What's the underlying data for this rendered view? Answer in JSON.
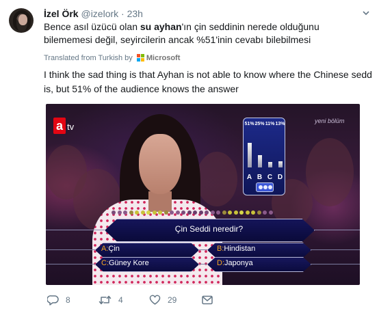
{
  "tweet": {
    "author_name": "İzel Örk",
    "author_handle": "@izelork",
    "separator": "·",
    "time": "23h",
    "text_before": "Bence asıl üzücü olan ",
    "text_bold": "su ayhan",
    "text_after": "'ın çin seddinin nerede olduğunu bilememesi değil, seyircilerin ancak %51'inin cevabı bilebilmesi",
    "translated_label": "Translated from Turkish by",
    "translator_name": "Microsoft",
    "translation": "I think the sad thing is that Ayhan is not able to know where the Chinese sedd is, but 51% of the audience knows the answer"
  },
  "media": {
    "channel_logo_a": "a",
    "channel_logo_tv": "tv",
    "corner_tag": "yeni bölüm",
    "audience_poll": {
      "percentages": [
        "51%",
        "25%",
        "11%",
        "13%"
      ],
      "values": [
        51,
        25,
        11,
        13
      ],
      "letters": [
        "A",
        "B",
        "C",
        "D"
      ]
    },
    "question": "Çin Seddi neredir?",
    "answers": [
      {
        "key": "A:",
        "text": "Çin"
      },
      {
        "key": "B:",
        "text": "Hindistan"
      },
      {
        "key": "C:",
        "text": "Güney Kore"
      },
      {
        "key": "D:",
        "text": "Japonya"
      }
    ]
  },
  "actions": {
    "replies": "8",
    "retweets": "4",
    "likes": "29"
  },
  "colors": {
    "name": "#14171a",
    "muted": "#657786",
    "brand_red": "#e30613",
    "panel_blue": "#1d2a8a",
    "answer_key": "#f5a623"
  }
}
